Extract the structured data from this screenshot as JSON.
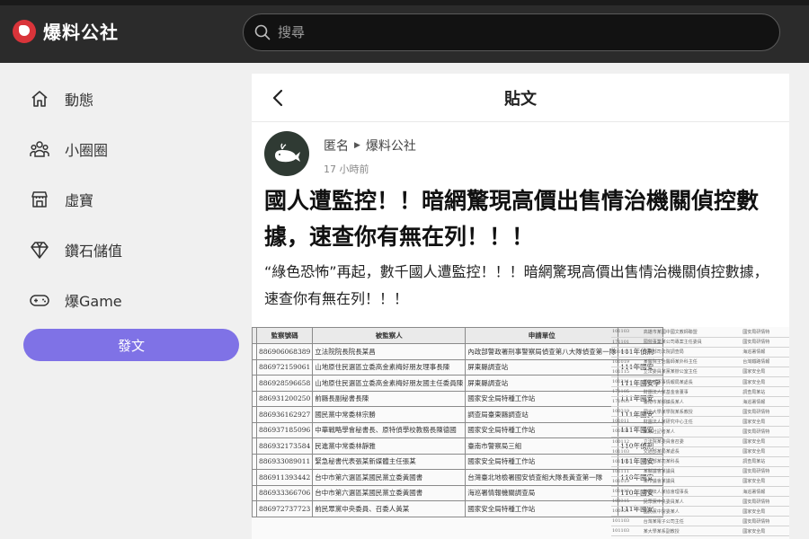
{
  "brand": {
    "name": "爆料公社"
  },
  "search": {
    "placeholder": "搜尋"
  },
  "sidebar": {
    "items": [
      {
        "label": "動態",
        "icon": "home-icon"
      },
      {
        "label": "小圈圈",
        "icon": "group-icon"
      },
      {
        "label": "虛寶",
        "icon": "shop-icon"
      },
      {
        "label": "鑽石儲值",
        "icon": "diamond-icon"
      },
      {
        "label": "爆Game",
        "icon": "gamepad-icon"
      }
    ],
    "post_button": "發文"
  },
  "post": {
    "header_title": "貼文",
    "author": "匿名",
    "group": "爆料公社",
    "time": "17 小時前",
    "title": "國人遭監控！！暗網驚現高價出售情治機關偵控數據，速查你有無在列！！！",
    "body": "“綠色恐怖”再起，數千國人遭監控！！！暗網驚現高價出售情治機關偵控數據，速查你有無在列！！！",
    "image_table": {
      "headers": [
        "監察號碼",
        "被監察人",
        "申請單位",
        ""
      ],
      "rows": [
        [
          "886906068389",
          "立法院院長院長某昌",
          "內政部警政署刑事警察局偵查第八大隊偵查第一隊",
          "111年偵刑"
        ],
        [
          "886972159061",
          "山地原住民選區立委高金素梅好朋友理事長陳",
          "屏東縣調查站",
          "111年國安"
        ],
        [
          "886928596658",
          "山地原住民選區立委高金素梅好朋友國主任委員陳",
          "屏東縣調查站",
          "111年國安字"
        ],
        [
          "886931200250",
          "前縣長副秘書長陳",
          "國家安全局特種工作站",
          "111年國安"
        ],
        [
          "886936162927",
          "國民黨中常委林宗勝",
          "調查局臺東縣調查站",
          "111年國安"
        ],
        [
          "886937185096",
          "中華戰略學會秘書長、原特偵學校教務長陳德國",
          "國家安全局特種工作站",
          "111年國安"
        ],
        [
          "886932173584",
          "民進黨中常委林靜雅",
          "臺南市警察局三組",
          "110年偵刑"
        ],
        [
          "886933089011",
          "緊急秘書代表張某新媒體主任張某",
          "國家安全局特種工作站",
          "111年國安"
        ],
        [
          "886911393442",
          "台中市第六選區某國民黨立委黃國書",
          "台灣臺北地檢署國安偵查組大隊長黃查第一隊",
          "110年國安"
        ],
        [
          "886933366706",
          "台中市第六選區某國民黨立委黃國書",
          "海巡署情報機關調查局",
          "110年國安"
        ],
        [
          "886972737723",
          "前民眾黨中央委員、召委人黃某",
          "國家安全局特種工作站",
          "111年國安"
        ]
      ],
      "side_rows": [
        [
          "101103",
          "高雄市某國中國文教師聯盟",
          "國安局研情特"
        ],
        [
          "171101",
          "國營事業某公司專案主任委員",
          "國安局研情特"
        ],
        [
          "101015",
          "法務部司法院調查局",
          "海巡署情報"
        ],
        [
          "101019",
          "某醫院主治醫師某外科主任",
          "台灣鐵路情報"
        ],
        [
          "101115",
          "立法委員某黨某辦公室主任",
          "國家安全局"
        ],
        [
          "101211",
          "國防部軍事情報局某處長",
          "國家安全局"
        ],
        [
          "171105",
          "財團法人某基金會董事",
          "調查局某站"
        ],
        [
          "171003",
          "臺南市某鄉鎮長某人",
          "海巡署情報"
        ],
        [
          "100319",
          "國立大學某學院某系教授",
          "國安局研情特"
        ],
        [
          "101011",
          "財團法人某研究中心主任",
          "國家安全局"
        ],
        [
          "101031",
          "某報社記者某人",
          "國安局研情特"
        ],
        [
          "100112",
          "立法院某委員會召委",
          "國家安全局"
        ],
        [
          "101103",
          "交通部某局某處長",
          "國家安全局"
        ],
        [
          "101105",
          "內政部某司某科長",
          "調查局某站"
        ],
        [
          "101111",
          "某縣議會某議員",
          "國安局研情特"
        ],
        [
          "101019",
          "某市議會某議員",
          "國家安全局"
        ],
        [
          "101013",
          "財團法人某協會理事長",
          "海巡署情報"
        ],
        [
          "100315",
          "民眾黨中央委員某人",
          "國安局研情特"
        ],
        [
          "100321",
          "國民黨中常委某人",
          "國家安全局"
        ],
        [
          "101103",
          "台灣某電子公司主任",
          "國安局研情特"
        ],
        [
          "101103",
          "某大學某系副教授",
          "國家安全局"
        ]
      ]
    }
  }
}
